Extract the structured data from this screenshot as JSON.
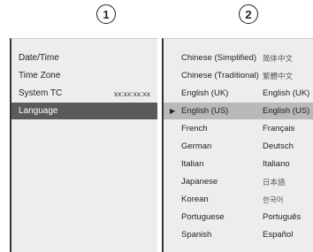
{
  "step_labels": [
    "1",
    "2"
  ],
  "settings_menu": {
    "items": [
      {
        "label": "Date/Time",
        "value": ""
      },
      {
        "label": "Time Zone",
        "value": ""
      },
      {
        "label": "System TC",
        "value": "xx:xx:xx:xx"
      },
      {
        "label": "Language",
        "value": ""
      }
    ],
    "selected_index": 3
  },
  "language_menu": {
    "items": [
      {
        "name": "Chinese (Simplified)",
        "native": "简体中文"
      },
      {
        "name": "Chinese (Traditional)",
        "native": "繁體中文"
      },
      {
        "name": "English (UK)",
        "native": "English (UK)"
      },
      {
        "name": "English (US)",
        "native": "English (US)"
      },
      {
        "name": "French",
        "native": "Français"
      },
      {
        "name": "German",
        "native": "Deutsch"
      },
      {
        "name": "Italian",
        "native": "Italiano"
      },
      {
        "name": "Japanese",
        "native": "日本語"
      },
      {
        "name": "Korean",
        "native": "한국어"
      },
      {
        "name": "Portuguese",
        "native": "Português"
      },
      {
        "name": "Spanish",
        "native": "Español"
      }
    ],
    "selected_index": 3,
    "current_marker": "▶"
  },
  "colors": {
    "panel_bg": "#ededed",
    "settings_selected_bg": "#5a5a5a",
    "language_selected_bg": "#b9b9b9"
  }
}
